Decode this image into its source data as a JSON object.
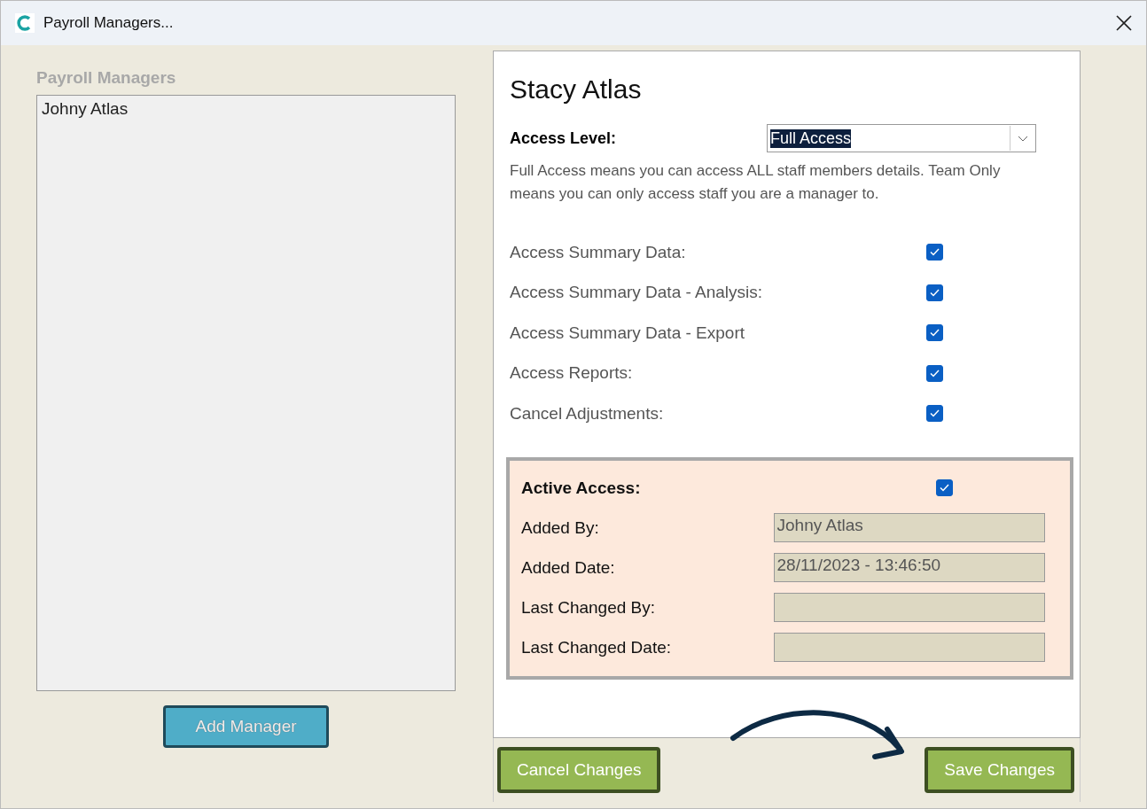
{
  "window": {
    "title": "Payroll Managers..."
  },
  "managers": {
    "heading": "Payroll Managers",
    "items": [
      {
        "name": "Johny Atlas",
        "selected": false
      }
    ],
    "add_button": "Add Manager"
  },
  "detail": {
    "name": "Stacy Atlas",
    "access_level": {
      "label": "Access Level:",
      "value": "Full Access"
    },
    "description": "Full Access means you can access ALL staff members details.  Team Only means you can only access staff you are a manager to.",
    "permissions": [
      {
        "label": "Access Summary Data:",
        "checked": true
      },
      {
        "label": "Access Summary Data - Analysis:",
        "checked": true
      },
      {
        "label": "Access Summary Data - Export",
        "checked": true
      },
      {
        "label": "Access Reports:",
        "checked": true
      },
      {
        "label": "Cancel Adjustments:",
        "checked": true
      }
    ],
    "audit": {
      "active": {
        "label": "Active Access:",
        "checked": true
      },
      "fields": [
        {
          "label": "Added By:",
          "value": "Johny Atlas"
        },
        {
          "label": "Added Date:",
          "value": "28/11/2023 - 13:46:50"
        },
        {
          "label": "Last Changed By:"
        },
        {
          "label": "Last Changed Date:"
        }
      ]
    }
  },
  "buttons": {
    "cancel": "Cancel Changes",
    "save": "Save Changes"
  }
}
